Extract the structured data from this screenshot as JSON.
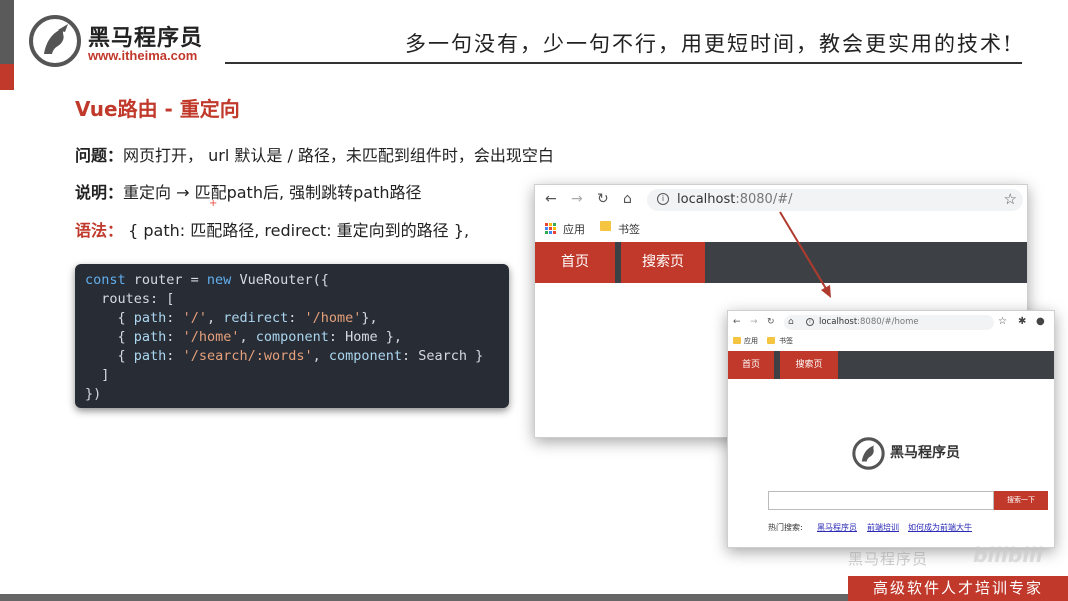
{
  "header": {
    "logo_name": "黑马程序员",
    "logo_url": "www.itheima.com",
    "slogan": "多一句没有，少一句不行，用更短时间，教会更实用的技术!"
  },
  "slide": {
    "title": "Vue路由 - 重定向",
    "problem_label": "问题：",
    "problem_text": "网页打开， url 默认是 / 路径，未匹配到组件时，会出现空白",
    "explain_label": "说明：",
    "explain_text": "重定向 → 匹配path后, 强制跳转path路径",
    "syntax_label": "语法：",
    "syntax_text": " { path: 匹配路径, redirect: 重定向到的路径 },"
  },
  "code": {
    "l1_a": "const",
    "l1_b": " router = ",
    "l1_c": "new",
    "l1_d": " VueRouter({",
    "l2": "  routes: [",
    "l3_a": "    { ",
    "l3_b": "path",
    "l3_c": ": ",
    "l3_d": "'/'",
    "l3_e": ", ",
    "l3_f": "redirect",
    "l3_g": ": ",
    "l3_h": "'/home'",
    "l3_i": "},",
    "l4_a": "    { ",
    "l4_b": "path",
    "l4_c": ": ",
    "l4_d": "'/home'",
    "l4_e": ", ",
    "l4_f": "component",
    "l4_g": ": Home },",
    "l5_a": "    { ",
    "l5_b": "path",
    "l5_c": ": ",
    "l5_d": "'/search/:words'",
    "l5_e": ", ",
    "l5_f": "component",
    "l5_g": ": Search }",
    "l6": "  ]",
    "l7": "})"
  },
  "browser1": {
    "url_host": "localhost",
    "url_path": ":8080/#/",
    "bookmark_apps": "应用",
    "bookmark_books": "书签",
    "tab_home": "首页",
    "tab_search": "搜索页"
  },
  "browser2": {
    "url_host": "localhost",
    "url_path": ":8080/#/home",
    "bookmark_apps": "应用",
    "bookmark_books": "书签",
    "tab_home": "首页",
    "tab_search": "搜索页",
    "logo_name": "黑马程序员",
    "search_button": "搜索一下",
    "hot_label": "热门搜索:",
    "hot_links": [
      "黑马程序员",
      "前端培训",
      "如何成为前端大牛"
    ]
  },
  "footer": {
    "banner": "高级软件人才培训专家",
    "watermark": "黑马程序员",
    "watermark_site": "bilibili"
  },
  "colors": {
    "brand_red": "#c0392b",
    "nav_dark": "#3d4145",
    "code_bg": "#282c34"
  }
}
